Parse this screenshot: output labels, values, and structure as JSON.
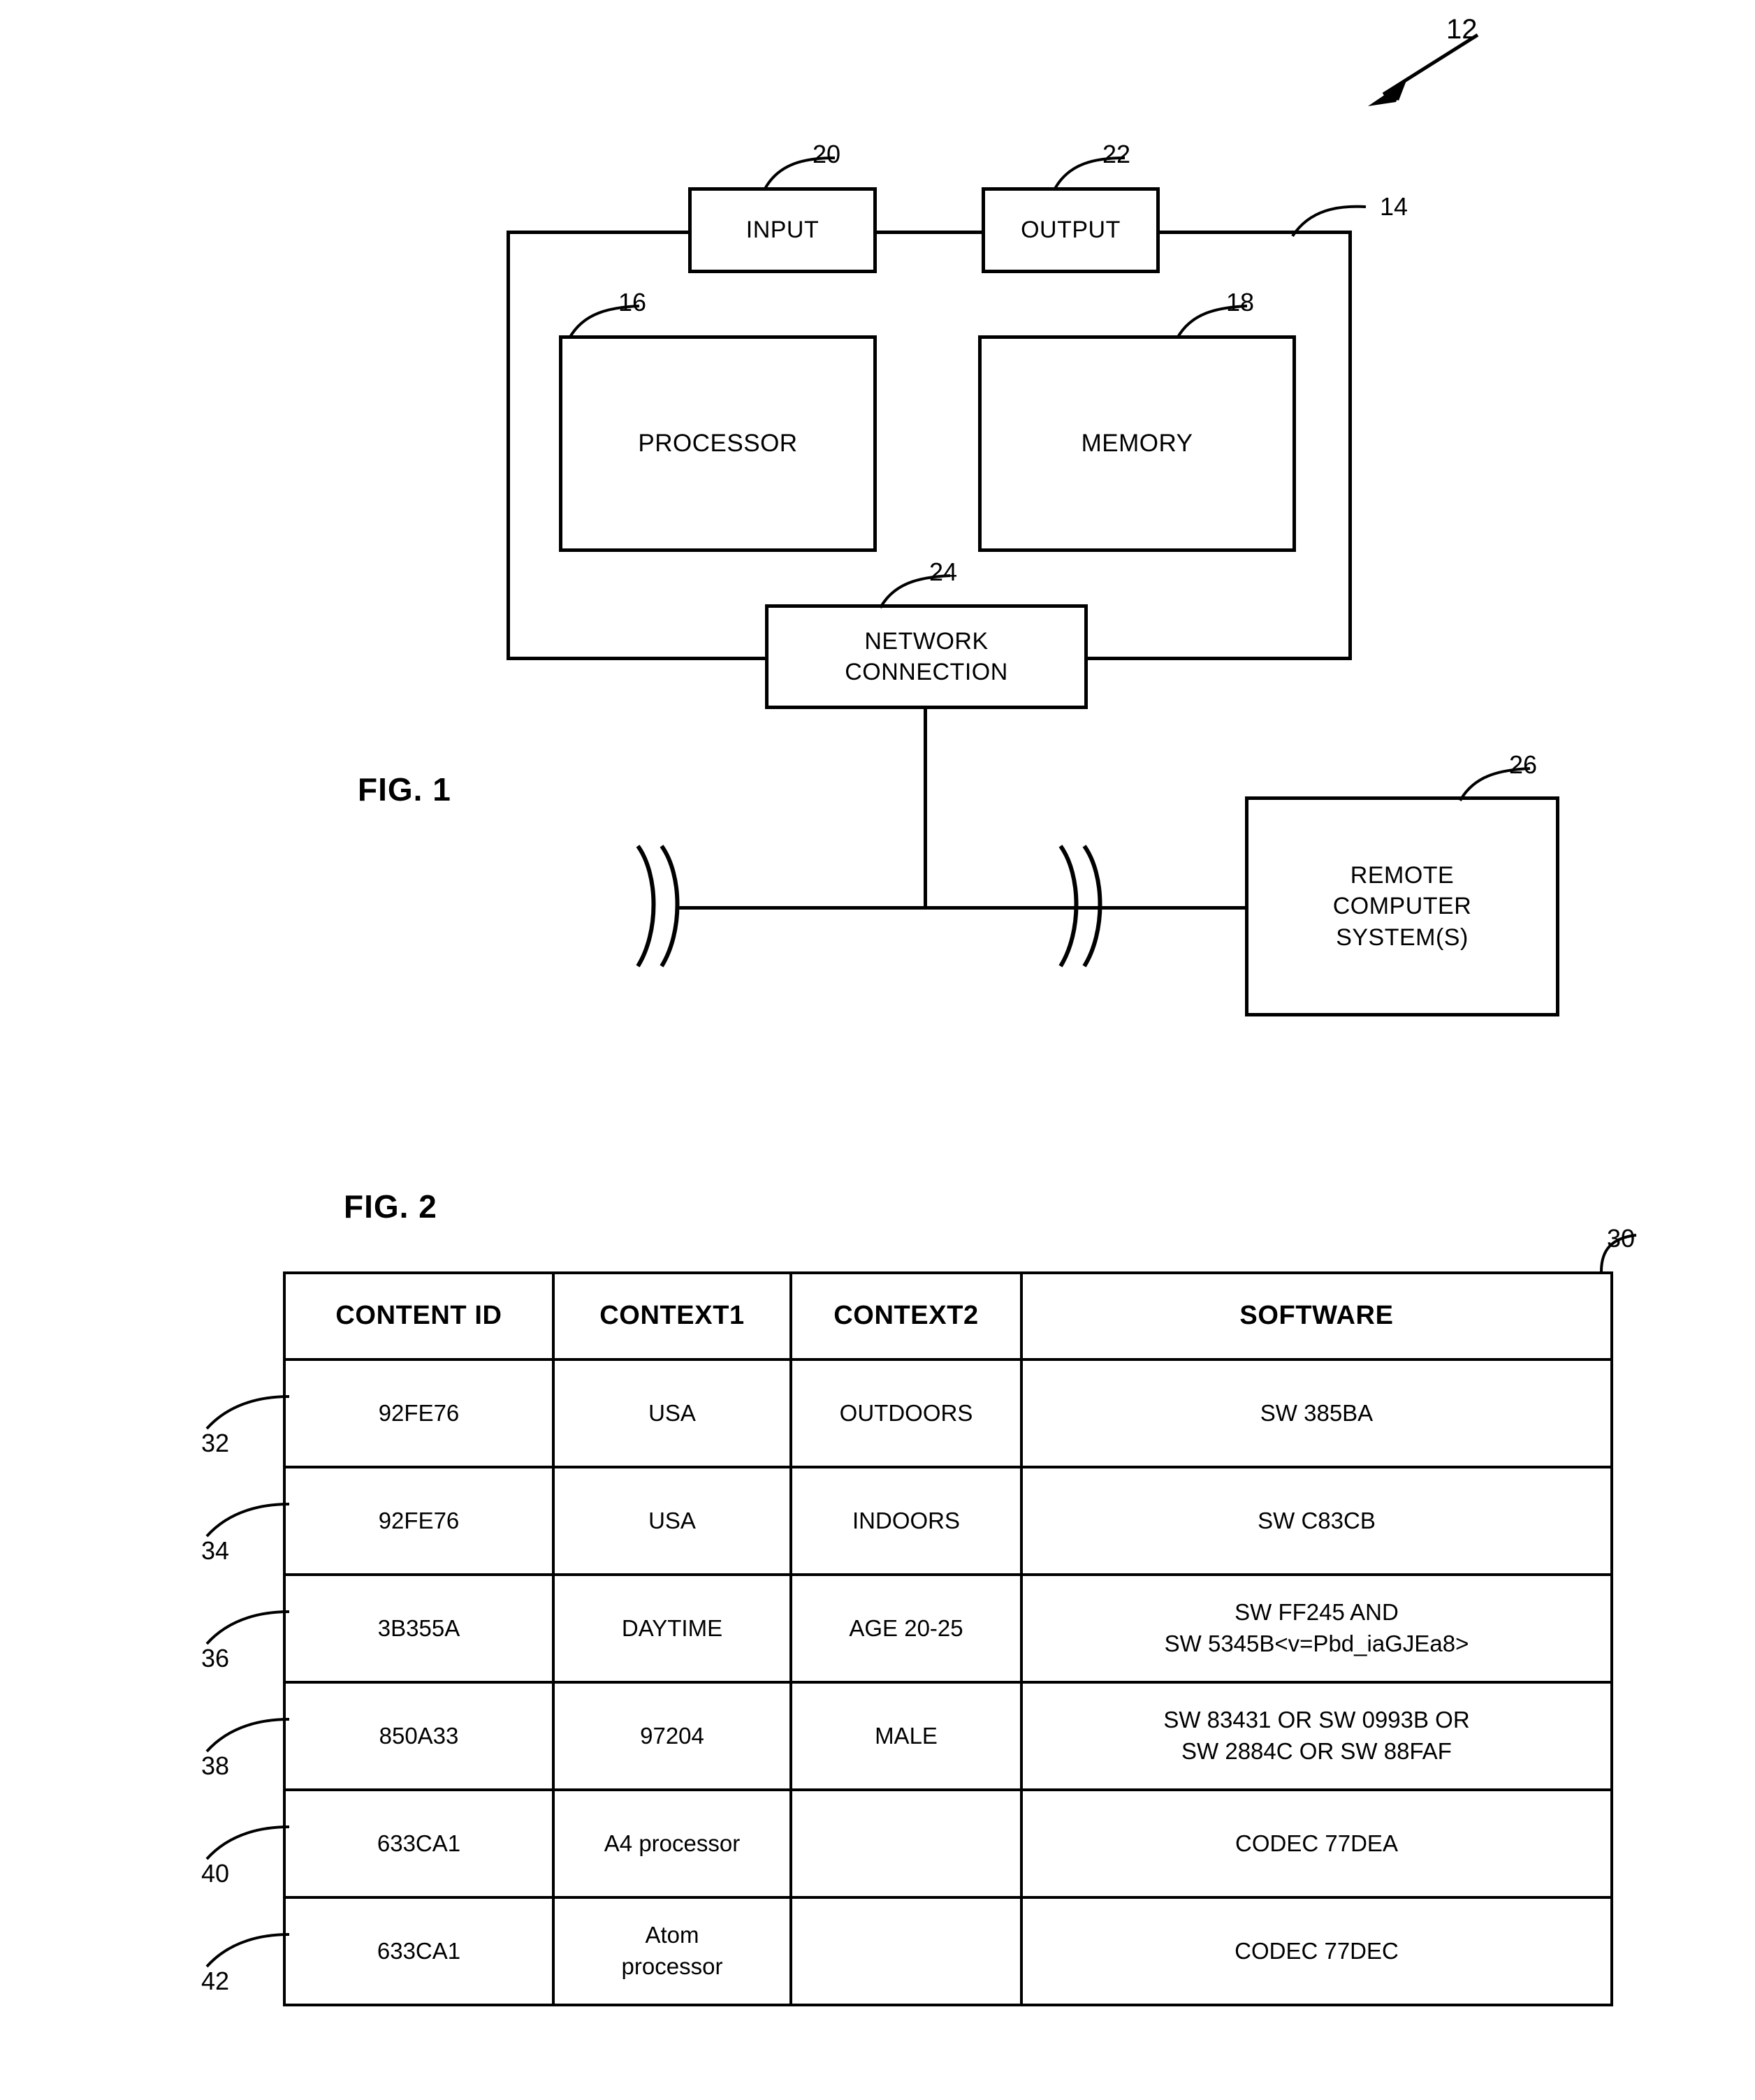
{
  "figures": {
    "fig1": {
      "caption": "FIG. 1",
      "system_ref": "12",
      "blocks": [
        {
          "id": "input",
          "label": "INPUT",
          "ref": "20"
        },
        {
          "id": "output",
          "label": "OUTPUT",
          "ref": "22"
        },
        {
          "id": "processor",
          "label": "PROCESSOR",
          "ref": "16"
        },
        {
          "id": "memory",
          "label": "MEMORY",
          "ref": "18"
        },
        {
          "id": "network",
          "label": "NETWORK\nCONNECTION",
          "ref": "24"
        },
        {
          "id": "remote",
          "label": "REMOTE\nCOMPUTER\nSYSTEM(S)",
          "ref": "26"
        }
      ],
      "bus_ref": "14",
      "labels": {
        "input": "INPUT",
        "output": "OUTPUT",
        "processor": "PROCESSOR",
        "memory": "MEMORY",
        "network_line1": "NETWORK",
        "network_line2": "CONNECTION",
        "remote_line1": "REMOTE",
        "remote_line2": "COMPUTER",
        "remote_line3": "SYSTEM(S)"
      },
      "refs": {
        "system": "12",
        "bus": "14",
        "processor": "16",
        "memory": "18",
        "input": "20",
        "output": "22",
        "network": "24",
        "remote": "26"
      }
    },
    "fig2": {
      "caption": "FIG. 2",
      "table_ref": "30",
      "table": {
        "headers": [
          "CONTENT ID",
          "CONTEXT1",
          "CONTEXT2",
          "SOFTWARE"
        ],
        "rows": [
          {
            "ref": "32",
            "content_id": "92FE76",
            "context1": "USA",
            "context2": "OUTDOORS",
            "software": "SW 385BA"
          },
          {
            "ref": "34",
            "content_id": "92FE76",
            "context1": "USA",
            "context2": "INDOORS",
            "software": "SW C83CB"
          },
          {
            "ref": "36",
            "content_id": "3B355A",
            "context1": "DAYTIME",
            "context2": "AGE 20-25",
            "software": "SW FF245 AND\nSW 5345B<v=Pbd_iaGJEa8>"
          },
          {
            "ref": "38",
            "content_id": "850A33",
            "context1": "97204",
            "context2": "MALE",
            "software": "SW 83431 OR SW 0993B OR\nSW 2884C OR SW 88FAF"
          },
          {
            "ref": "40",
            "content_id": "633CA1",
            "context1": "A4 processor",
            "context2": "",
            "software": "CODEC 77DEA"
          },
          {
            "ref": "42",
            "content_id": "633CA1",
            "context1": "Atom\nprocessor",
            "context2": "",
            "software": "CODEC 77DEC"
          }
        ]
      }
    }
  },
  "colors": {
    "ink": "#000000",
    "paper": "#ffffff"
  }
}
